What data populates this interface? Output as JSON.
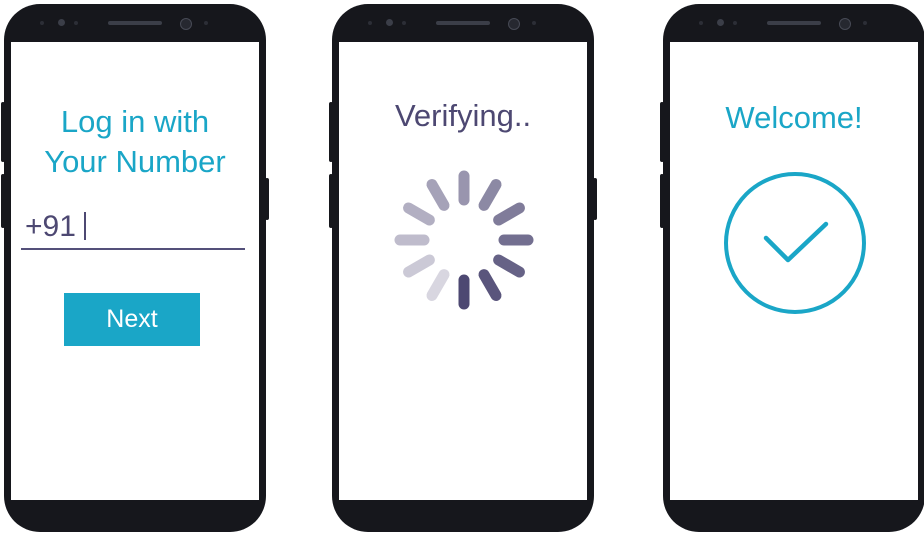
{
  "screens": {
    "login": {
      "title_line1": "Log in with",
      "title_line2": "Your Number",
      "phone_value": "+91",
      "next_label": "Next"
    },
    "verifying": {
      "title": "Verifying.."
    },
    "welcome": {
      "title": "Welcome!"
    }
  },
  "icons": {
    "spinner": "loading-spinner-icon",
    "success": "checkmark-circle-icon"
  },
  "colors": {
    "accent": "#1aa6c7",
    "text_dark": "#4d4872",
    "phone_body": "#16171c",
    "spinner_dark": "#4d4872",
    "spinner_light": "#d8d6e0"
  }
}
